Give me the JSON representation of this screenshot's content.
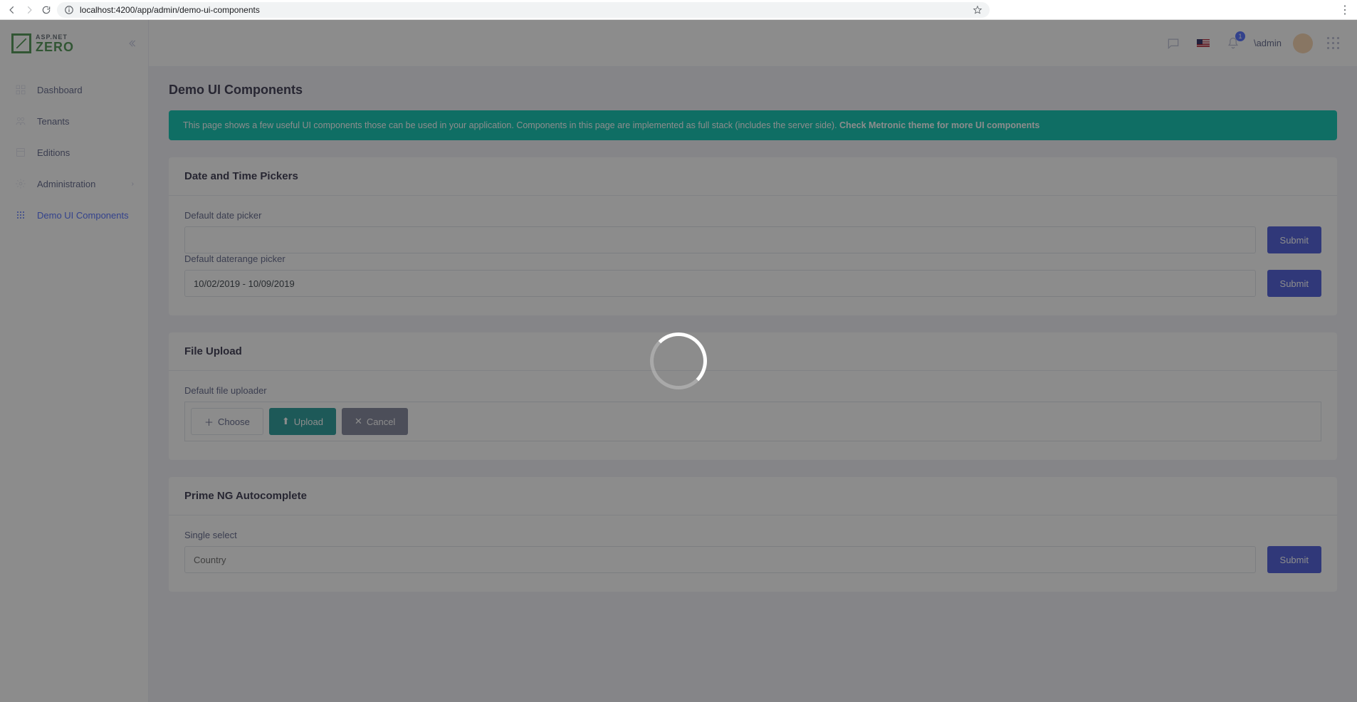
{
  "browser": {
    "url": "localhost:4200/app/admin/demo-ui-components"
  },
  "brand": {
    "upper": "ASP.NET",
    "lower": "ZERO"
  },
  "sidebar": {
    "items": [
      {
        "label": "Dashboard"
      },
      {
        "label": "Tenants"
      },
      {
        "label": "Editions"
      },
      {
        "label": "Administration"
      },
      {
        "label": "Demo UI Components"
      }
    ]
  },
  "topbar": {
    "notification_count": "1",
    "user_label": "\\admin"
  },
  "page": {
    "title": "Demo UI Components",
    "alert_text": "This page shows a few useful UI components those can be used in your application. Components in this page are implemented as full stack (includes the server side). ",
    "alert_link": "Check Metronic theme for more UI components"
  },
  "sections": {
    "date": {
      "heading": "Date and Time Pickers",
      "label_date": "Default date picker",
      "label_range": "Default daterange picker",
      "range_value": "10/02/2019 - 10/09/2019",
      "submit": "Submit"
    },
    "upload": {
      "heading": "File Upload",
      "label": "Default file uploader",
      "choose": "Choose",
      "upload": "Upload",
      "cancel": "Cancel"
    },
    "autocomplete": {
      "heading": "Prime NG Autocomplete",
      "label_single": "Single select",
      "placeholder": "Country",
      "submit": "Submit"
    }
  }
}
